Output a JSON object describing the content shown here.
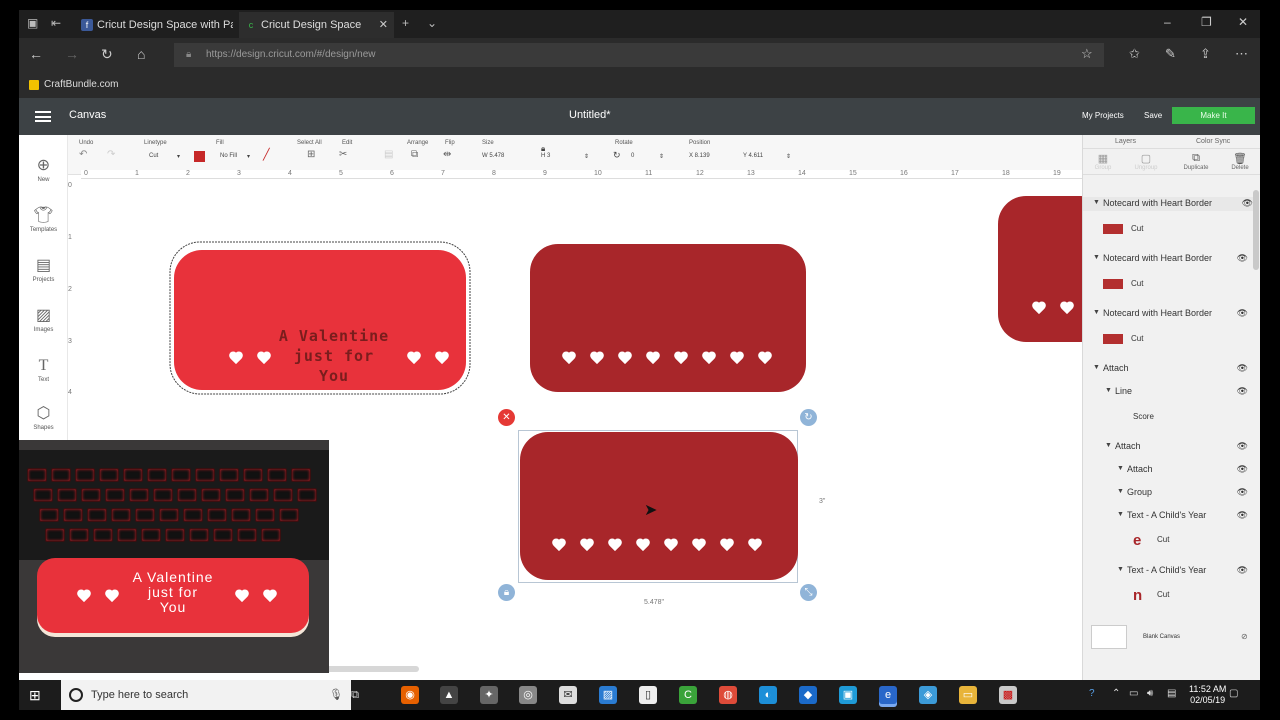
{
  "browser": {
    "tabs": [
      {
        "label": "Cricut Design Space with Pa",
        "icon": "facebook-icon"
      },
      {
        "label": "Cricut Design Space",
        "icon": "cricut-icon"
      }
    ],
    "url": "https://design.cricut.com/#/design/new",
    "favorites": [
      {
        "label": "CraftBundle.com"
      }
    ]
  },
  "app": {
    "menu_label": "Canvas",
    "doc_title": "Untitled*",
    "my_projects": "My Projects",
    "save": "Save",
    "make_it": "Make It"
  },
  "toolbar": {
    "undo": "Undo",
    "linetype": "Linetype",
    "linetype_value": "Cut",
    "fill": "Fill",
    "fill_value": "No Fill",
    "select_all": "Select All",
    "edit": "Edit",
    "arrange": "Arrange",
    "flip": "Flip",
    "size": "Size",
    "size_w": "W  5.478",
    "size_h": "H  3",
    "rotate": "Rotate",
    "rotate_value": "0",
    "position": "Position",
    "pos_x": "X  8.139",
    "pos_y": "Y  4.611"
  },
  "ruler": {
    "h": [
      "0",
      "1",
      "2",
      "3",
      "4",
      "5",
      "6",
      "7",
      "8",
      "9",
      "10",
      "11",
      "12",
      "13",
      "14",
      "15",
      "16",
      "17",
      "18",
      "19"
    ],
    "v": [
      "0",
      "1",
      "2",
      "3",
      "4"
    ]
  },
  "sidebar": {
    "items": [
      {
        "label": "New",
        "icon": "plus-icon"
      },
      {
        "label": "Templates",
        "icon": "shirt-icon"
      },
      {
        "label": "Projects",
        "icon": "projects-icon"
      },
      {
        "label": "Images",
        "icon": "image-icon"
      },
      {
        "label": "Text",
        "icon": "text-icon"
      },
      {
        "label": "Shapes",
        "icon": "shapes-icon"
      }
    ]
  },
  "canvas": {
    "card1_text": "A Valentine\njust for\nYou",
    "height_label": "3\"",
    "width_label": "5.478\""
  },
  "panel": {
    "tabs": [
      "Layers",
      "Color Sync"
    ],
    "tools": [
      "Group",
      "Ungroup",
      "Duplicate",
      "Delete"
    ],
    "layers": [
      {
        "name": "Notecard with Heart Border",
        "sub": "Cut"
      },
      {
        "name": "Notecard with Heart Border",
        "sub": "Cut"
      },
      {
        "name": "Notecard with Heart Border",
        "sub": "Cut"
      }
    ],
    "attach1": "Attach",
    "line": "Line",
    "score": "Score",
    "attach2": "Attach",
    "attach3": "Attach",
    "group": "Group",
    "text1": "Text - A Child's Year",
    "text1_sub": "Cut",
    "text2": "Text - A Child's Year",
    "text2_sub": "Cut",
    "blank_canvas": "Blank Canvas"
  },
  "webcam": {
    "card_text": "A Valentine\njust for\nYou"
  },
  "taskbar": {
    "search_placeholder": "Type here to search",
    "time": "11:52 AM",
    "date": "02/05/19"
  },
  "colors": {
    "card_bright": "#e8323b",
    "card_dark": "#a8262a",
    "make_it": "#39b54a"
  }
}
